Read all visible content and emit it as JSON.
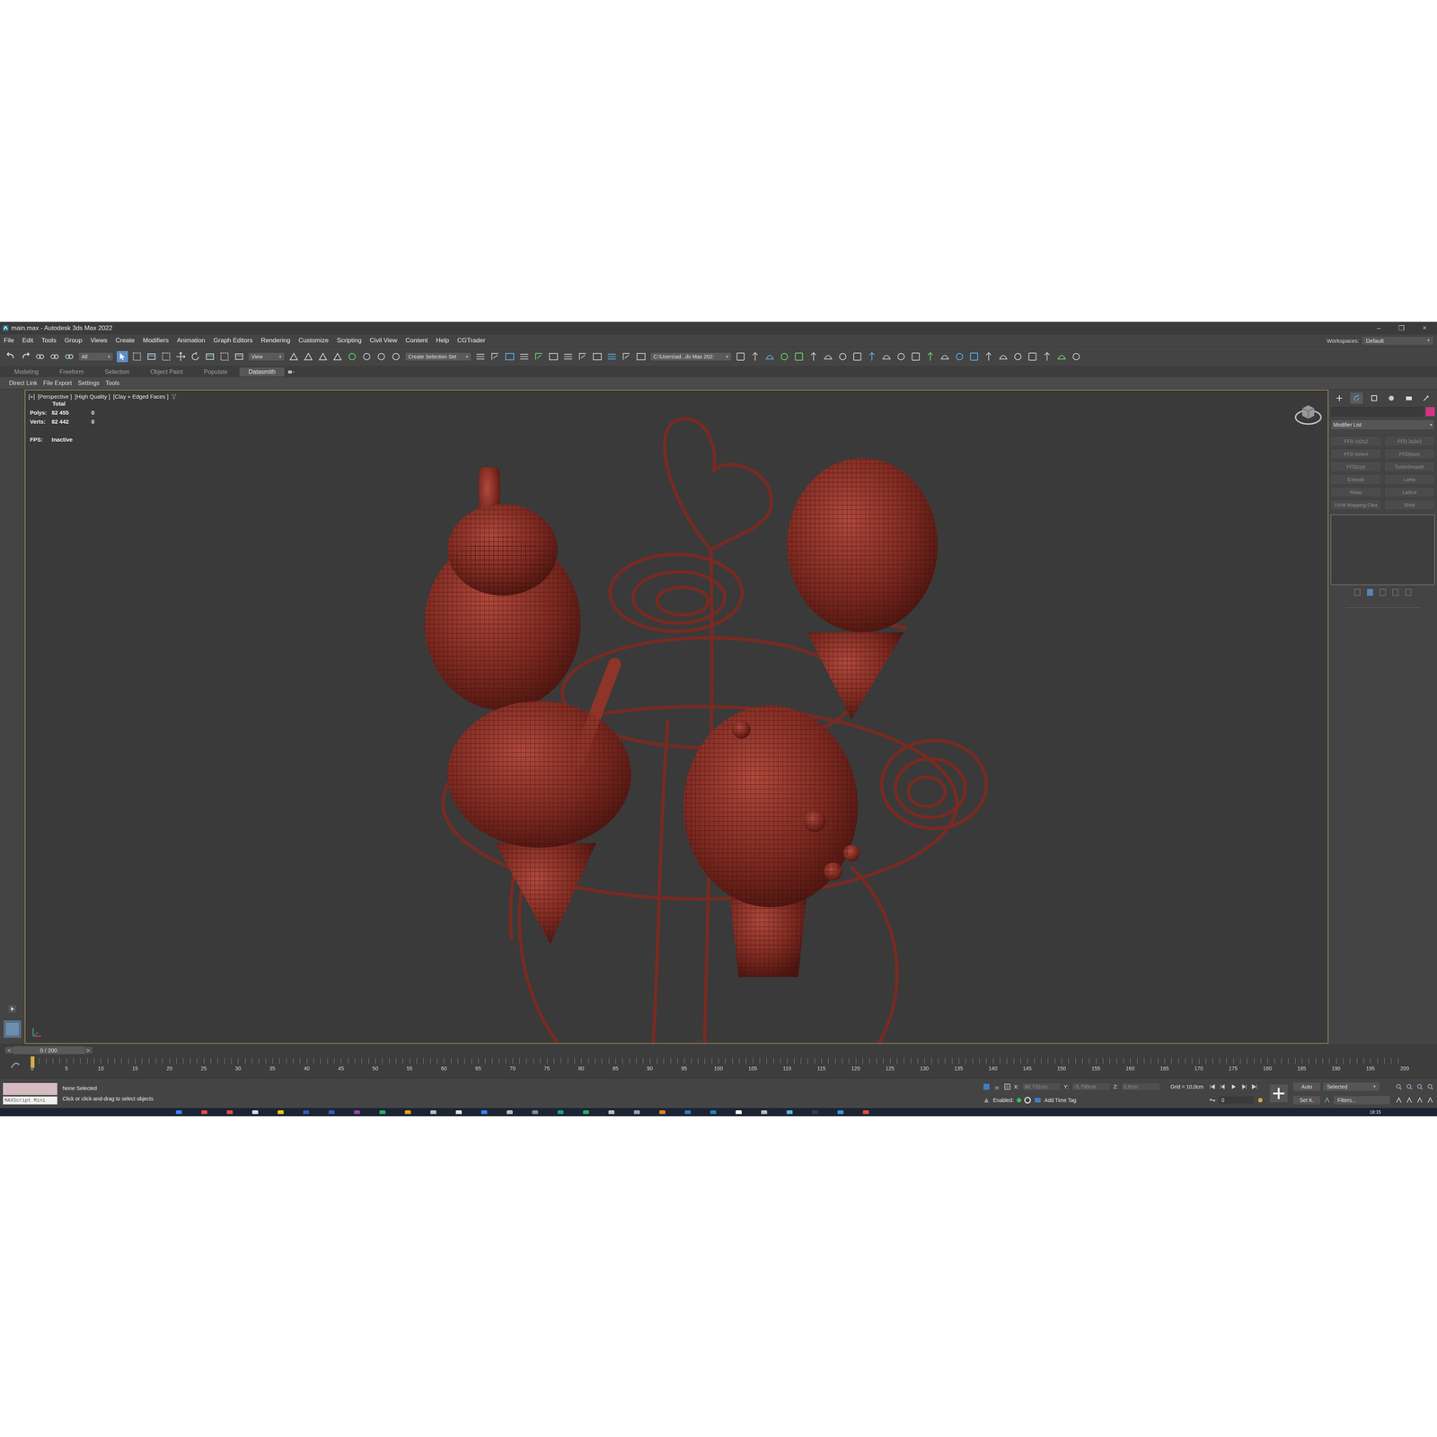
{
  "window": {
    "title": "main.max - Autodesk 3ds Max 2022",
    "controls": [
      "–",
      "❐",
      "×"
    ]
  },
  "menu": [
    "File",
    "Edit",
    "Tools",
    "Group",
    "Views",
    "Create",
    "Modifiers",
    "Animation",
    "Graph Editors",
    "Rendering",
    "Customize",
    "Scripting",
    "Civil View",
    "Content",
    "Help",
    "CGTrader"
  ],
  "workspaces": {
    "label": "Workspaces:",
    "value": "Default"
  },
  "toolbar": {
    "selection_filter": "All",
    "reference_coord": "View",
    "selection_set": "Create Selection Set",
    "project_path": "C:\\Users\\ad...ds Max 202:",
    "select_tool_active": true
  },
  "ribbon_tabs": [
    {
      "label": "Modeling",
      "selected": false
    },
    {
      "label": "Freeform",
      "selected": false
    },
    {
      "label": "Selection",
      "selected": false
    },
    {
      "label": "Object Paint",
      "selected": false
    },
    {
      "label": "Populate",
      "selected": false
    },
    {
      "label": "Datasmith",
      "selected": true
    }
  ],
  "ribbon_items": [
    "Direct Link",
    "File Export",
    "Settings",
    "Tools"
  ],
  "viewport": {
    "labels": [
      "[+]",
      "[Perspective ]",
      "[High Quality ]",
      "[Clay + Edged Faces ]"
    ],
    "stats_header": "Total",
    "stats": [
      {
        "label": "Polys:",
        "total": "82 455",
        "selection": "0"
      },
      {
        "label": "Verts:",
        "total": "82 442",
        "selection": "0"
      }
    ],
    "fps_label": "FPS:",
    "fps_value": "Inactive"
  },
  "command_panel": {
    "tabs": [
      {
        "selected": false
      },
      {
        "selected": true
      },
      {
        "selected": false
      },
      {
        "selected": false
      },
      {
        "selected": false
      },
      {
        "selected": false
      }
    ],
    "modifier_list": "Modifier List",
    "modifiers": [
      "FFD 2x2x2",
      "FFD 3x3x3",
      "FFD 4x4x4",
      "FFD(box)",
      "FFD(cyl)",
      "TurboSmooth",
      "Extrude",
      "Lathe",
      "Relax",
      "Lattice",
      "UVW Mapping Clea",
      "Shell"
    ],
    "object_color": "#d63384"
  },
  "timeline": {
    "frame": "0 / 200",
    "prev": "<",
    "next": ">",
    "ticks": [
      "0",
      "5",
      "10",
      "15",
      "20",
      "25",
      "30",
      "35",
      "40",
      "45",
      "50",
      "55",
      "60",
      "65",
      "70",
      "75",
      "80",
      "85",
      "90",
      "95",
      "100",
      "105",
      "110",
      "115",
      "120",
      "125",
      "130",
      "135",
      "140",
      "145",
      "150",
      "155",
      "160",
      "165",
      "170",
      "175",
      "180",
      "185",
      "190",
      "195",
      "200"
    ]
  },
  "status": {
    "selection": "None Selected",
    "prompt": "Click or click-and-drag to select objects",
    "maxscript": "MAXScript Mini",
    "x_label": "X:",
    "x": "86,731cm",
    "y_label": "Y:",
    "y": "-5,790cm",
    "z_label": "Z:",
    "z": "0,0cm",
    "grid": "Grid = 10,0cm",
    "enabled_label": "Enabled:",
    "time_tag": "Add Time Tag",
    "current_frame": "0",
    "auto_key": "Auto",
    "key_filter": "Selected",
    "set_key": "Set K.",
    "filters": "Filters..."
  },
  "taskbar": {
    "time": "18:15"
  }
}
